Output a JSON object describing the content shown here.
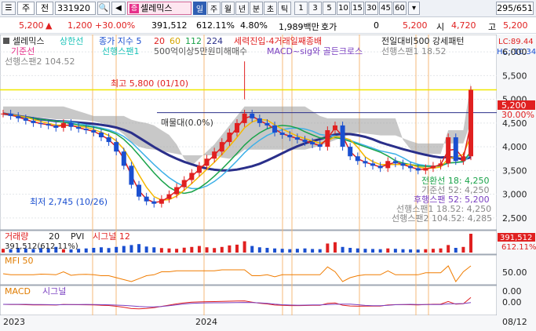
{
  "toolbar": {
    "menu_icon": "☰",
    "sel1": "주",
    "sel2": "전",
    "code": "331920",
    "search_icon": "🔍",
    "sound_icon": "◀",
    "stock_badge": "증",
    "stock_name": "셀레믹스",
    "periods": [
      "일",
      "주",
      "월",
      "년",
      "분",
      "초",
      "틱"
    ],
    "active_period": "일",
    "numbers": [
      "1",
      "3",
      "5",
      "10",
      "15",
      "30",
      "45",
      "60"
    ],
    "page": "295/651"
  },
  "quote": {
    "price": "5,200",
    "up_arrow": "▲",
    "change": "1,200",
    "change_pct": "+30.00%",
    "volume": "391,512",
    "vol_pct": "612.11%",
    "ratio": "4.80%",
    "amount": "1,989백만",
    "hoga_label": "호가",
    "hoga": "0",
    "hoga_price": "5,200",
    "open_label": "시",
    "open": "4,720",
    "high_label": "고",
    "high": "5,200"
  },
  "legend": {
    "line1": [
      "셀레믹스",
      "상한선",
      "종가 지수 5",
      "20",
      "60",
      "112",
      "224",
      "세력진입-4거래일째종배",
      "전일대비500 강세패턴"
    ],
    "line2": [
      "기준선",
      "선행스팬1",
      "500억이상5만원미해매수",
      "MACD~sig와 골든크로스",
      "선행스팬1 18.52"
    ],
    "line3": "선행스팬2 104.52",
    "lc": "LC:89.44",
    "hc": "HC:-10.34"
  },
  "chart_data": {
    "type": "candlestick",
    "price_axis": [
      "6,000",
      "5,500",
      "5,000",
      "4,500",
      "4,000",
      "3,500",
      "3,000",
      "2,500"
    ],
    "price_ylim": [
      2300,
      6300
    ],
    "current_price_label": "5,200",
    "current_pct_label": "30.00%",
    "high_annotation": "최고 5,800 (01/10)",
    "low_annotation": "최저 2,745 (10/26)",
    "base_annotation": "매물대(0.0%)",
    "right_labels": [
      "전환선 18: 4,250",
      "기준선 52: 4,250",
      "후행스팬 52: 5,200",
      "선행스팬1 18.52: 4,250",
      "선행스팬2 104.52: 4,285"
    ],
    "x_labels": [
      "2023",
      "2024",
      "08/12"
    ],
    "close": [
      4700,
      4650,
      4600,
      4550,
      4500,
      4480,
      4450,
      4400,
      4500,
      4420,
      4380,
      4350,
      4300,
      4200,
      4100,
      3900,
      3600,
      3200,
      2950,
      2850,
      2800,
      2900,
      3000,
      3150,
      3300,
      3450,
      3600,
      3750,
      3900,
      4100,
      4300,
      4500,
      4700,
      4600,
      4500,
      4450,
      4300,
      4250,
      4200,
      4150,
      4100,
      4050,
      4000,
      4350,
      4450,
      4000,
      3800,
      3700,
      3650,
      3600,
      3550,
      3700,
      3650,
      3600,
      3550,
      3500,
      3550,
      3600,
      3650,
      4200,
      3700,
      3800,
      5200
    ]
  },
  "volume_panel": {
    "title": "거래량",
    "period": "20",
    "pvi": "PVI",
    "signal": "시그널 12",
    "value": "391,512(612.11%)",
    "axis_top": "391,512",
    "axis_pct": "612.11%",
    "values": [
      20,
      18,
      25,
      22,
      19,
      24,
      21,
      30,
      18,
      17,
      20,
      22,
      25,
      28,
      24,
      30,
      35,
      40,
      45,
      32,
      28,
      24,
      22,
      20,
      26,
      30,
      35,
      28,
      24,
      30,
      38,
      42,
      60,
      35,
      28,
      25,
      22,
      20,
      18,
      20,
      22,
      19,
      18,
      48,
      55,
      30,
      25,
      22,
      20,
      19,
      18,
      22,
      20,
      18,
      17,
      16,
      18,
      20,
      22,
      40,
      25,
      30,
      100
    ]
  },
  "mfi_panel": {
    "title": "MFI 50",
    "axis": [
      "50.00",
      "0.00"
    ]
  },
  "macd_panel": {
    "title": "MACD",
    "signal": "시그널",
    "axis": [
      "0.00"
    ]
  },
  "colors": {
    "up": "#e02020",
    "down": "#1a4fd0",
    "ma5": "#e02020",
    "ma20": "#f5b800",
    "ma60": "#1aa34a",
    "ma112": "#3db0e8",
    "ma224": "#2a2f8a",
    "ceiling": "#f0e800"
  }
}
